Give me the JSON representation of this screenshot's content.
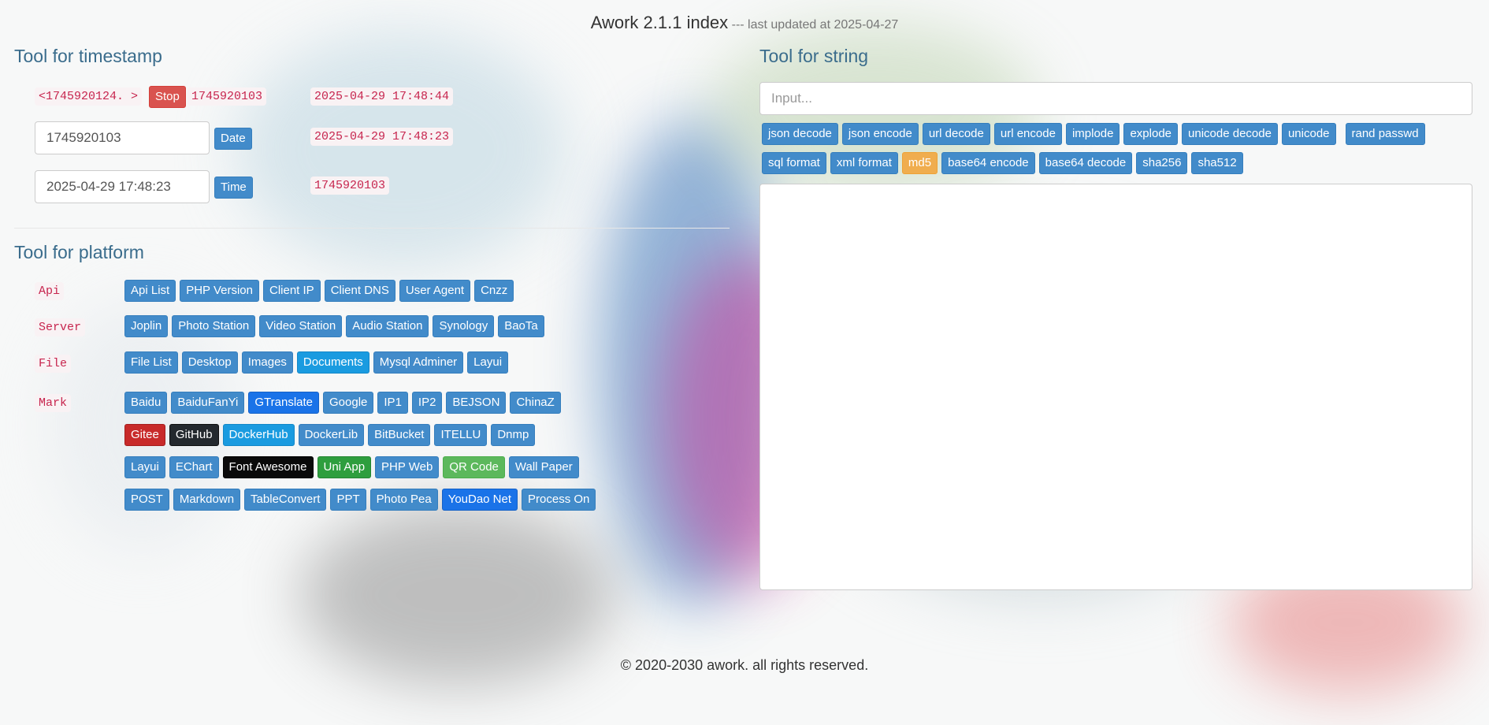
{
  "header": {
    "title": "Awork 2.1.1 index",
    "subtitle": "--- last updated at 2025-04-27"
  },
  "timestamp": {
    "heading": "Tool for timestamp",
    "live_ts": "<1745920124. >",
    "stop_label": "Stop",
    "frozen_ts": "1745920103",
    "live_datetime": "2025-04-29 17:48:44",
    "ts_input_value": "1745920103",
    "date_label": "Date",
    "date_result": "2025-04-29 17:48:23",
    "date_input_value": "2025-04-29 17:48:23",
    "time_label": "Time",
    "time_result": "1745920103"
  },
  "platform": {
    "heading": "Tool for platform",
    "groups": [
      {
        "label": "Api",
        "buttons": [
          "Api List",
          "PHP Version",
          "Client IP",
          "Client DNS",
          "User Agent",
          "Cnzz"
        ]
      },
      {
        "label": "Server",
        "buttons": [
          "Joplin",
          "Photo Station",
          "Video Station",
          "Audio Station",
          "Synology",
          "BaoTa"
        ]
      },
      {
        "label": "File",
        "buttons": [
          "File List",
          "Desktop",
          "Images",
          "Documents",
          "Mysql Adminer",
          "Layui"
        ]
      },
      {
        "label": "Mark",
        "rows": [
          [
            "Baidu",
            "BaiduFanYi",
            "GTranslate",
            "Google",
            "IP1",
            "IP2",
            "BEJSON",
            "ChinaZ"
          ],
          [
            "Gitee",
            "GitHub",
            "DockerHub",
            "DockerLib",
            "BitBucket",
            "ITELLU",
            "Dnmp"
          ],
          [
            "Layui",
            "EChart",
            "Font Awesome",
            "Uni App",
            "PHP Web",
            "QR Code",
            "Wall Paper"
          ],
          [
            "POST",
            "Markdown",
            "TableConvert",
            "PPT",
            "Photo Pea",
            "YouDao Net",
            "Process On"
          ]
        ]
      }
    ]
  },
  "string": {
    "heading": "Tool for string",
    "input_placeholder": "Input...",
    "buttons_row1": [
      "json decode",
      "json encode",
      "url decode",
      "url encode",
      "implode",
      "explode",
      "unicode decode",
      "unicode",
      "rand passwd"
    ],
    "buttons_row2": [
      "sql format",
      "xml format",
      "md5",
      "base64 encode",
      "base64 decode",
      "sha256",
      "sha512"
    ]
  },
  "colors": {
    "primary": "#428bca",
    "danger": "#d9534f",
    "warning": "#f0ad4e",
    "success": "#5cb85c",
    "heading": "#3a6c8c"
  },
  "footer": {
    "text": "© 2020-2030 awork. all rights reserved."
  }
}
